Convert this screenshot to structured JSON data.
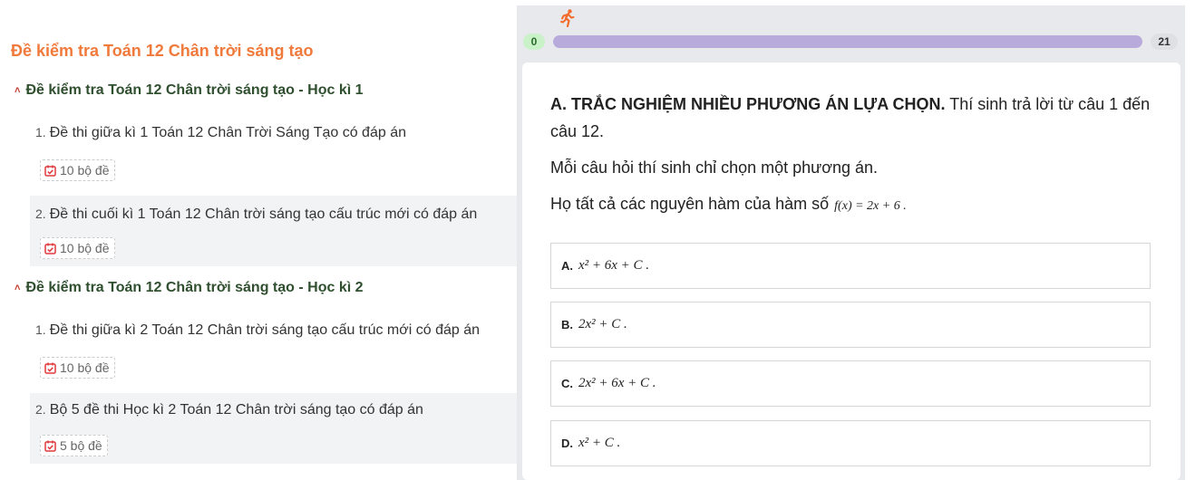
{
  "sidebar": {
    "title": "Đề kiểm tra Toán 12 Chân trời sáng tạo",
    "sections": [
      {
        "title": "Đề kiểm tra Toán 12 Chân trời sáng tạo - Học kì 1",
        "items": [
          {
            "num": "1.",
            "label": "Đề thi giữa kì 1 Toán 12 Chân Trời Sáng Tạo có đáp án",
            "badge": "10 bộ đề"
          },
          {
            "num": "2.",
            "label": "Đề thi cuối kì 1 Toán 12 Chân trời sáng tạo cấu trúc mới có đáp án",
            "badge": "10 bộ đề"
          }
        ]
      },
      {
        "title": "Đề kiểm tra Toán 12 Chân trời sáng tạo - Học kì 2",
        "items": [
          {
            "num": "1.",
            "label": "Đề thi giữa kì 2 Toán 12 Chân trời sáng tạo cấu trúc mới có đáp án",
            "badge": "10 bộ đề"
          },
          {
            "num": "2.",
            "label": "Bộ 5 đề thi Học kì 2 Toán 12 Chân trời sáng tạo có đáp án",
            "badge": "5 bộ đề"
          }
        ]
      }
    ]
  },
  "quiz": {
    "progress": {
      "start": "0",
      "end": "21",
      "fraction": 1.0
    },
    "heading_bold": "A. TRẮC NGHIỆM NHIỀU PHƯƠNG ÁN LỰA CHỌN.",
    "heading_rest": " Thí sinh trả lời từ câu 1 đến câu 12.",
    "instruction": "Mỗi câu hỏi thí sinh chỉ chọn một phương án.",
    "question": "Họ tất cả các nguyên hàm của hàm số",
    "formula": "f(x) = 2x + 6 .",
    "options": [
      {
        "letter": "A.",
        "expr": "x² + 6x + C ."
      },
      {
        "letter": "B.",
        "expr": "2x² + C ."
      },
      {
        "letter": "C.",
        "expr": "2x² + 6x + C ."
      },
      {
        "letter": "D.",
        "expr": "x² + C ."
      }
    ]
  },
  "colors": {
    "title_orange": "#f07a3c",
    "section_green": "#2f4f2f",
    "progress_fill": "#b8abdc",
    "badge_icon_red": "#e0393b",
    "runner_orange": "#f26b2a"
  },
  "icons": {
    "section_toggle": "chevron-up-icon",
    "badge": "calendar-check-icon",
    "progress": "runner-icon"
  }
}
